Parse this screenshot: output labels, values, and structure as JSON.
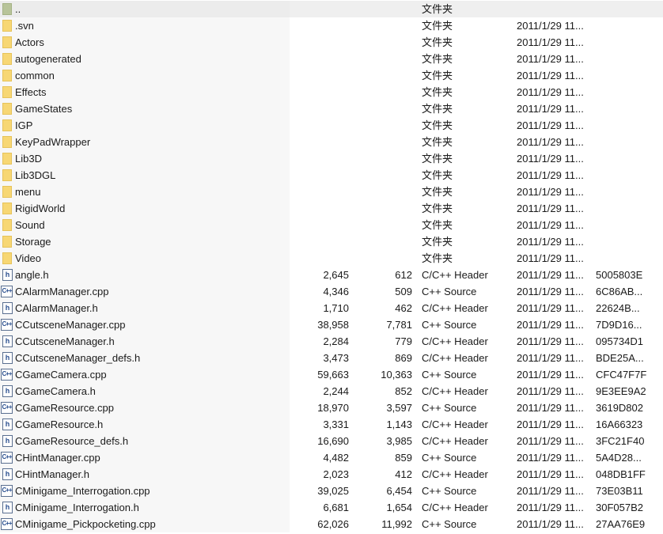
{
  "files": [
    {
      "name": "..",
      "size": "",
      "packed": "",
      "type": "文件夹",
      "modified": "",
      "crc": "",
      "icon": "parent-folder-icon"
    },
    {
      "name": ".svn",
      "size": "",
      "packed": "",
      "type": "文件夹",
      "modified": "2011/1/29 11...",
      "crc": "",
      "icon": "folder-icon"
    },
    {
      "name": "Actors",
      "size": "",
      "packed": "",
      "type": "文件夹",
      "modified": "2011/1/29 11...",
      "crc": "",
      "icon": "folder-icon"
    },
    {
      "name": "autogenerated",
      "size": "",
      "packed": "",
      "type": "文件夹",
      "modified": "2011/1/29 11...",
      "crc": "",
      "icon": "folder-icon"
    },
    {
      "name": "common",
      "size": "",
      "packed": "",
      "type": "文件夹",
      "modified": "2011/1/29 11...",
      "crc": "",
      "icon": "folder-icon"
    },
    {
      "name": "Effects",
      "size": "",
      "packed": "",
      "type": "文件夹",
      "modified": "2011/1/29 11...",
      "crc": "",
      "icon": "folder-icon"
    },
    {
      "name": "GameStates",
      "size": "",
      "packed": "",
      "type": "文件夹",
      "modified": "2011/1/29 11...",
      "crc": "",
      "icon": "folder-icon"
    },
    {
      "name": "IGP",
      "size": "",
      "packed": "",
      "type": "文件夹",
      "modified": "2011/1/29 11...",
      "crc": "",
      "icon": "folder-icon"
    },
    {
      "name": "KeyPadWrapper",
      "size": "",
      "packed": "",
      "type": "文件夹",
      "modified": "2011/1/29 11...",
      "crc": "",
      "icon": "folder-icon"
    },
    {
      "name": "Lib3D",
      "size": "",
      "packed": "",
      "type": "文件夹",
      "modified": "2011/1/29 11...",
      "crc": "",
      "icon": "folder-icon"
    },
    {
      "name": "Lib3DGL",
      "size": "",
      "packed": "",
      "type": "文件夹",
      "modified": "2011/1/29 11...",
      "crc": "",
      "icon": "folder-icon"
    },
    {
      "name": "menu",
      "size": "",
      "packed": "",
      "type": "文件夹",
      "modified": "2011/1/29 11...",
      "crc": "",
      "icon": "folder-icon"
    },
    {
      "name": "RigidWorld",
      "size": "",
      "packed": "",
      "type": "文件夹",
      "modified": "2011/1/29 11...",
      "crc": "",
      "icon": "folder-icon"
    },
    {
      "name": "Sound",
      "size": "",
      "packed": "",
      "type": "文件夹",
      "modified": "2011/1/29 11...",
      "crc": "",
      "icon": "folder-icon"
    },
    {
      "name": "Storage",
      "size": "",
      "packed": "",
      "type": "文件夹",
      "modified": "2011/1/29 11...",
      "crc": "",
      "icon": "folder-icon"
    },
    {
      "name": "Video",
      "size": "",
      "packed": "",
      "type": "文件夹",
      "modified": "2011/1/29 11...",
      "crc": "",
      "icon": "folder-icon"
    },
    {
      "name": "angle.h",
      "size": "2,645",
      "packed": "612",
      "type": "C/C++ Header",
      "modified": "2011/1/29 11...",
      "crc": "5005803E",
      "icon": "header-file-icon"
    },
    {
      "name": "CAlarmManager.cpp",
      "size": "4,346",
      "packed": "509",
      "type": "C++ Source",
      "modified": "2011/1/29 11...",
      "crc": "6C86AB...",
      "icon": "cpp-file-icon"
    },
    {
      "name": "CAlarmManager.h",
      "size": "1,710",
      "packed": "462",
      "type": "C/C++ Header",
      "modified": "2011/1/29 11...",
      "crc": "22624B...",
      "icon": "header-file-icon"
    },
    {
      "name": "CCutsceneManager.cpp",
      "size": "38,958",
      "packed": "7,781",
      "type": "C++ Source",
      "modified": "2011/1/29 11...",
      "crc": "7D9D16...",
      "icon": "cpp-file-icon"
    },
    {
      "name": "CCutsceneManager.h",
      "size": "2,284",
      "packed": "779",
      "type": "C/C++ Header",
      "modified": "2011/1/29 11...",
      "crc": "095734D1",
      "icon": "header-file-icon"
    },
    {
      "name": "CCutsceneManager_defs.h",
      "size": "3,473",
      "packed": "869",
      "type": "C/C++ Header",
      "modified": "2011/1/29 11...",
      "crc": "BDE25A...",
      "icon": "header-file-icon"
    },
    {
      "name": "CGameCamera.cpp",
      "size": "59,663",
      "packed": "10,363",
      "type": "C++ Source",
      "modified": "2011/1/29 11...",
      "crc": "CFC47F7F",
      "icon": "cpp-file-icon"
    },
    {
      "name": "CGameCamera.h",
      "size": "2,244",
      "packed": "852",
      "type": "C/C++ Header",
      "modified": "2011/1/29 11...",
      "crc": "9E3EE9A2",
      "icon": "header-file-icon"
    },
    {
      "name": "CGameResource.cpp",
      "size": "18,970",
      "packed": "3,597",
      "type": "C++ Source",
      "modified": "2011/1/29 11...",
      "crc": "3619D802",
      "icon": "cpp-file-icon"
    },
    {
      "name": "CGameResource.h",
      "size": "3,331",
      "packed": "1,143",
      "type": "C/C++ Header",
      "modified": "2011/1/29 11...",
      "crc": "16A66323",
      "icon": "header-file-icon"
    },
    {
      "name": "CGameResource_defs.h",
      "size": "16,690",
      "packed": "3,985",
      "type": "C/C++ Header",
      "modified": "2011/1/29 11...",
      "crc": "3FC21F40",
      "icon": "header-file-icon"
    },
    {
      "name": "CHintManager.cpp",
      "size": "4,482",
      "packed": "859",
      "type": "C++ Source",
      "modified": "2011/1/29 11...",
      "crc": "5A4D28...",
      "icon": "cpp-file-icon"
    },
    {
      "name": "CHintManager.h",
      "size": "2,023",
      "packed": "412",
      "type": "C/C++ Header",
      "modified": "2011/1/29 11...",
      "crc": "048DB1FF",
      "icon": "header-file-icon"
    },
    {
      "name": "CMinigame_Interrogation.cpp",
      "size": "39,025",
      "packed": "6,454",
      "type": "C++ Source",
      "modified": "2011/1/29 11...",
      "crc": "73E03B11",
      "icon": "cpp-file-icon"
    },
    {
      "name": "CMinigame_Interrogation.h",
      "size": "6,681",
      "packed": "1,654",
      "type": "C/C++ Header",
      "modified": "2011/1/29 11...",
      "crc": "30F057B2",
      "icon": "header-file-icon"
    },
    {
      "name": "CMinigame_Pickpocketing.cpp",
      "size": "62,026",
      "packed": "11,992",
      "type": "C++ Source",
      "modified": "2011/1/29 11...",
      "crc": "27AA76E9",
      "icon": "cpp-file-icon"
    }
  ]
}
